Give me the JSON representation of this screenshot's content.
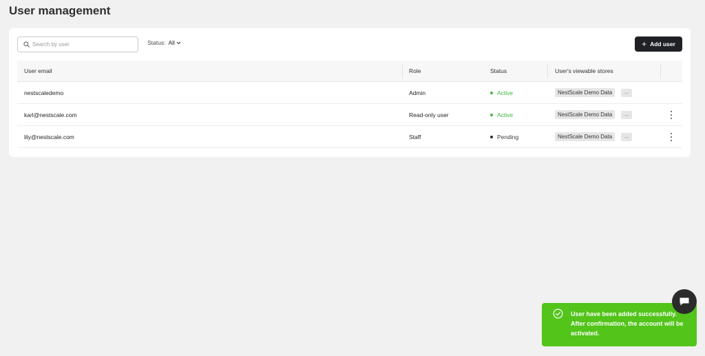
{
  "page": {
    "title": "User management"
  },
  "toolbar": {
    "search_placeholder": "Search by user",
    "search_value": "",
    "status_label": "Status:",
    "status_value": "All",
    "add_user_label": "Add user"
  },
  "table": {
    "columns": {
      "email": "User email",
      "role": "Role",
      "status": "Status",
      "stores": "User's viewable stores"
    },
    "rows": [
      {
        "email": "nestscaledemo",
        "role": "Admin",
        "status": "Active",
        "store": "NestScale Demo Data",
        "more": "..."
      },
      {
        "email": "karl@nestscale.com",
        "role": "Read-only user",
        "status": "Active",
        "store": "NestScale Demo Data",
        "more": "..."
      },
      {
        "email": "lily@nestscale.com",
        "role": "Staff",
        "status": "Pending",
        "store": "NestScale Demo Data",
        "more": "..."
      }
    ]
  },
  "toast": {
    "message": "User have been added successfully. After confirmation, the account will be activated.",
    "close": "X",
    "color": "#52c41a"
  },
  "colors": {
    "accent_dark": "#1f2124",
    "active": "#3cb73c"
  },
  "icons": {
    "search": "search-icon",
    "chevron": "chevron-down-icon",
    "plus": "plus-icon",
    "check": "check-circle-icon",
    "chat": "chat-icon",
    "kebab": "more-vertical-icon"
  }
}
